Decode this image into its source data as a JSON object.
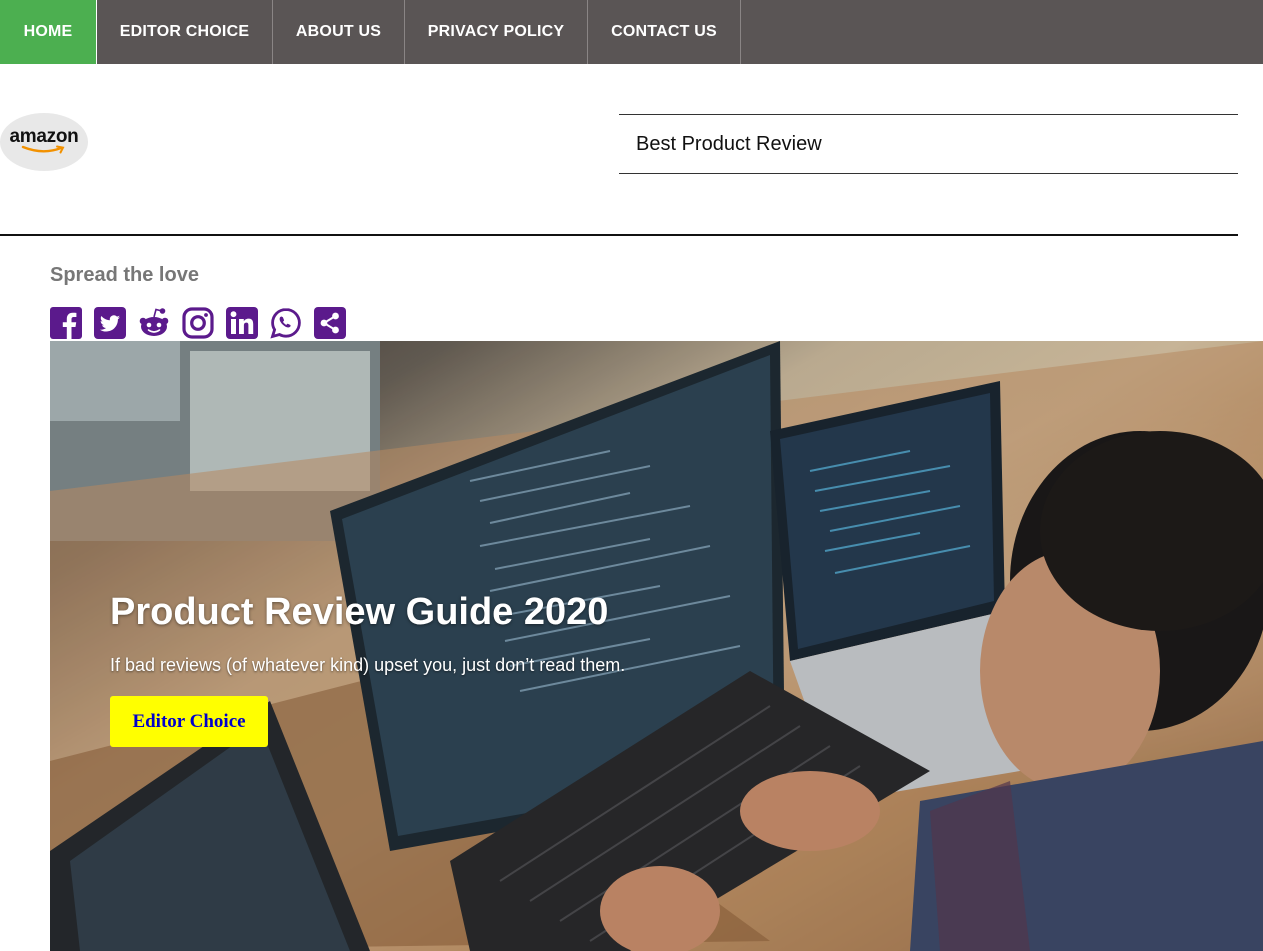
{
  "nav": {
    "items": [
      {
        "label": "HOME",
        "active": true
      },
      {
        "label": "EDITOR CHOICE",
        "active": false
      },
      {
        "label": "ABOUT US",
        "active": false
      },
      {
        "label": "PRIVACY POLICY",
        "active": false
      },
      {
        "label": "CONTACT US",
        "active": false
      }
    ],
    "bg_color": "#5a5555",
    "active_color": "#4caf50"
  },
  "header": {
    "logo_text": "amazon",
    "site_title": "Best Product Review"
  },
  "share": {
    "heading": "Spread the love",
    "icon_color": "#5b1a8c",
    "icons": [
      "facebook-icon",
      "twitter-icon",
      "reddit-icon",
      "instagram-icon",
      "linkedin-icon",
      "whatsapp-icon",
      "share-icon"
    ]
  },
  "hero": {
    "title": "Product Review Guide 2020",
    "subtitle": "If bad reviews (of whatever kind) upset you, just don’t read them.",
    "button_label": "Editor Choice",
    "button_color": "#ffff00"
  }
}
